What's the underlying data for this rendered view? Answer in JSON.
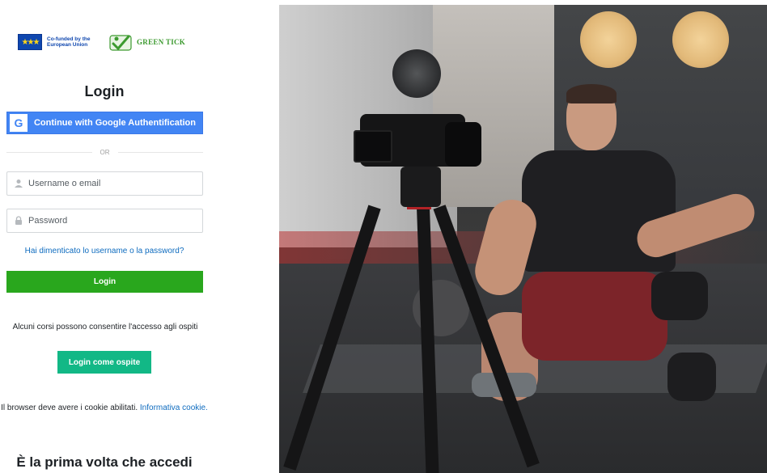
{
  "logos": {
    "eu_text": "Co-funded by the European Union",
    "partner_text": "GREEN TICK",
    "eu_flag_icon": "eu-flag-icon",
    "partner_icon": "green-tick-logo-icon"
  },
  "login": {
    "title": "Login",
    "google_button_label": "Continue with Google Authentification",
    "or_separator": "OR",
    "username_placeholder": "Username o email",
    "password_placeholder": "Password",
    "forgot_link": "Hai dimenticato lo username o la password?",
    "submit_label": "Login"
  },
  "guest": {
    "text": "Alcuni corsi possono consentire l'accesso agli ospiti",
    "button_label": "Login come ospite"
  },
  "cookies": {
    "text": "Il browser deve avere i cookie abilitati.",
    "link": "Informativa cookie."
  },
  "first_time": {
    "heading": "È la prima volta che accedi"
  },
  "colors": {
    "google_blue": "#4285f4",
    "login_green": "#29a71d",
    "guest_teal": "#12b886",
    "link_blue": "#0f6cbf"
  },
  "hero": {
    "description_icon": "gym-camera-photo"
  }
}
